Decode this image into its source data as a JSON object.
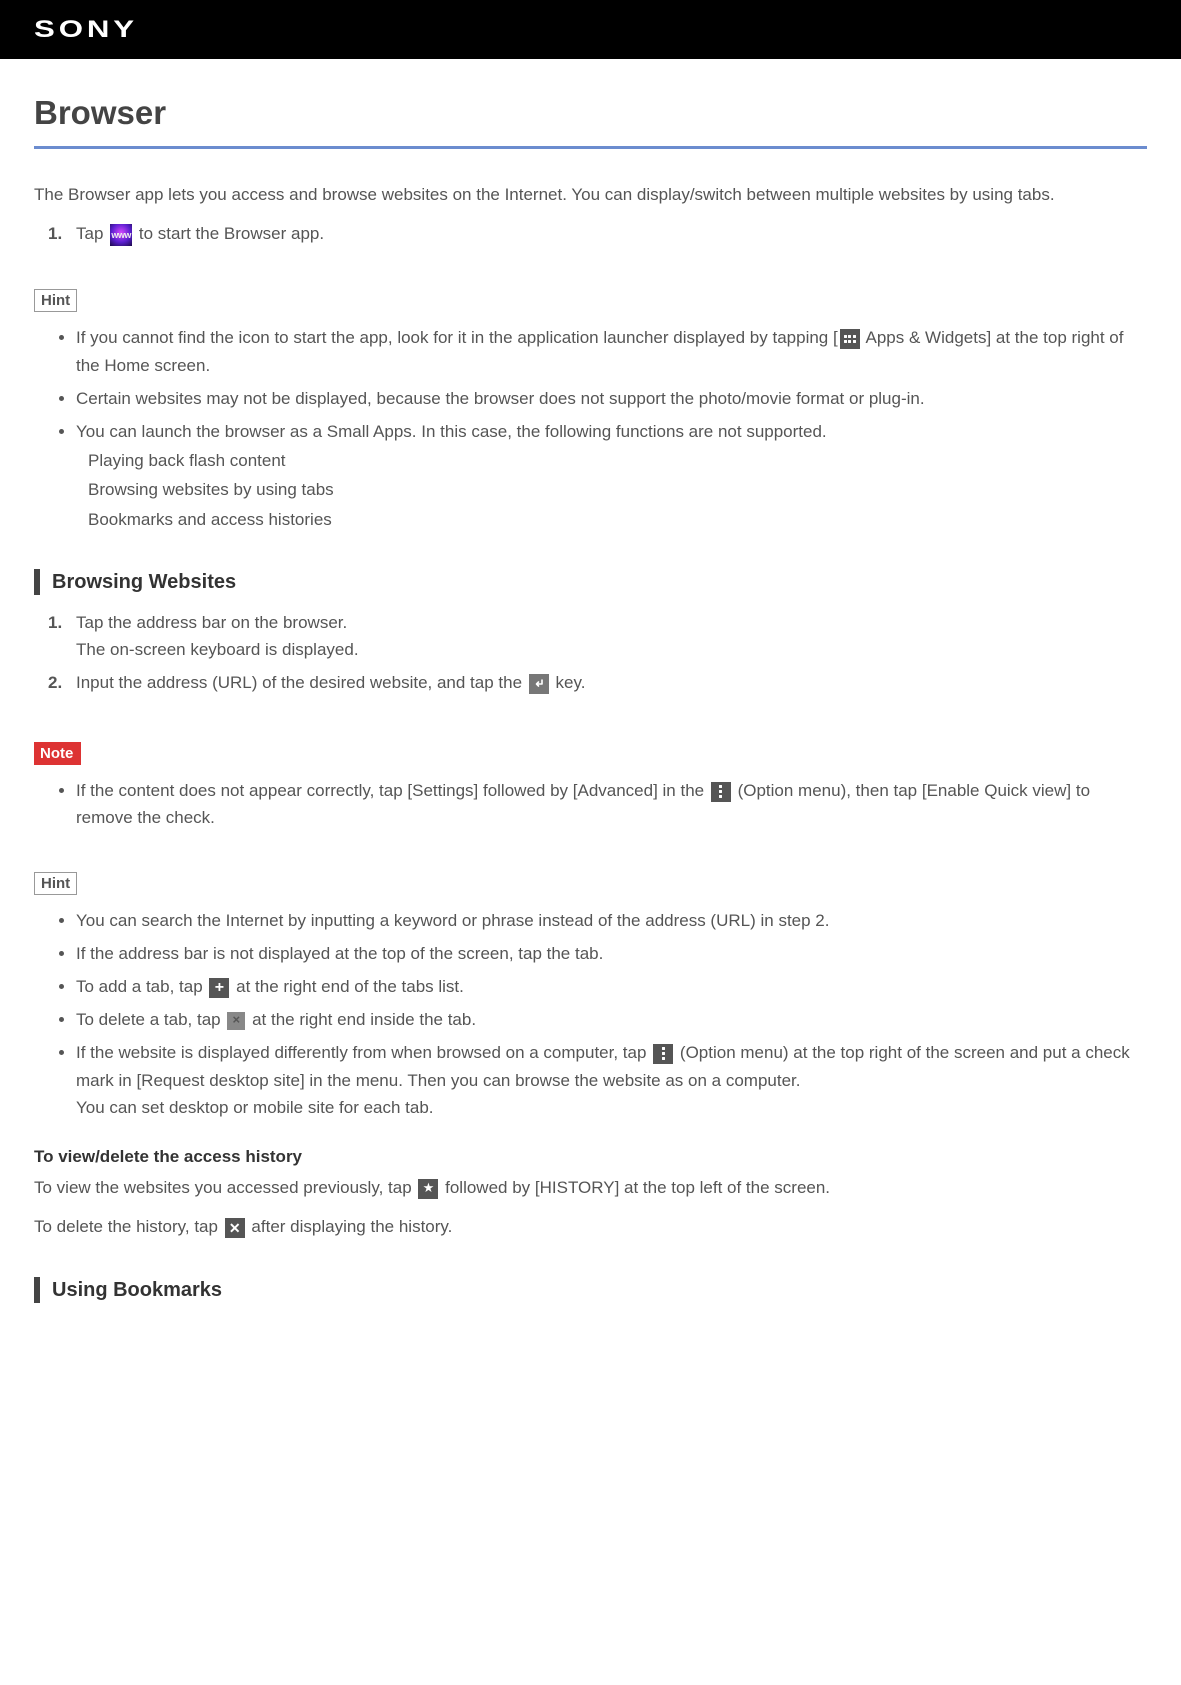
{
  "header": {
    "logo": "SONY"
  },
  "page": {
    "title": "Browser",
    "intro": "The Browser app lets you access and browse websites on the Internet. You can display/switch between multiple websites by using tabs.",
    "start_step_before": "Tap ",
    "start_step_after": " to start the Browser app.",
    "hint_label": "Hint",
    "note_label": "Note",
    "hint1": {
      "item1_before": "If you cannot find the icon to start the app, look for it in the application launcher displayed by tapping [",
      "item1_after": " Apps & Widgets] at the top right of the Home screen.",
      "item2": "Certain websites may not be displayed, because the browser does not support the photo/movie format or plug-in.",
      "item3": "You can launch the browser as a Small Apps. In this case, the following functions are not supported.",
      "item3_sub1": "Playing back flash content",
      "item3_sub2": "Browsing websites by using tabs",
      "item3_sub3": "Bookmarks and access histories"
    },
    "section_browsing": {
      "heading": "Browsing Websites",
      "step1_line1": "Tap the address bar on the browser.",
      "step1_line2": "The on-screen keyboard is displayed.",
      "step2_before": "Input the address (URL) of the desired website, and tap the ",
      "step2_after": " key."
    },
    "note_block": {
      "item1_before": "If the content does not appear correctly, tap [Settings] followed by [Advanced] in the ",
      "item1_after": " (Option menu), then tap [Enable Quick view] to remove the check."
    },
    "hint2": {
      "item1": "You can search the Internet by inputting a keyword or phrase instead of the address (URL) in step 2.",
      "item2": "If the address bar is not displayed at the top of the screen, tap the tab.",
      "item3_before": "To add a tab, tap ",
      "item3_after": " at the right end of the tabs list.",
      "item4_before": "To delete a tab, tap ",
      "item4_after": " at the right end inside the tab.",
      "item5_before": "If the website is displayed differently from when browsed on a computer, tap ",
      "item5_mid": " (Option menu) at the top right of the screen and put a check mark in [Request desktop site] in the menu. Then you can browse the website as on a computer.",
      "item5_last": "You can set desktop or mobile site for each tab."
    },
    "history": {
      "heading": "To view/delete the access history",
      "line1_before": "To view the websites you accessed previously, tap ",
      "line1_after": " followed by [HISTORY] at the top left of the screen.",
      "line2_before": "To delete the history, tap ",
      "line2_after": " after displaying the history."
    },
    "section_bookmarks": {
      "heading": "Using Bookmarks"
    },
    "icon_text": {
      "www": "www"
    }
  }
}
